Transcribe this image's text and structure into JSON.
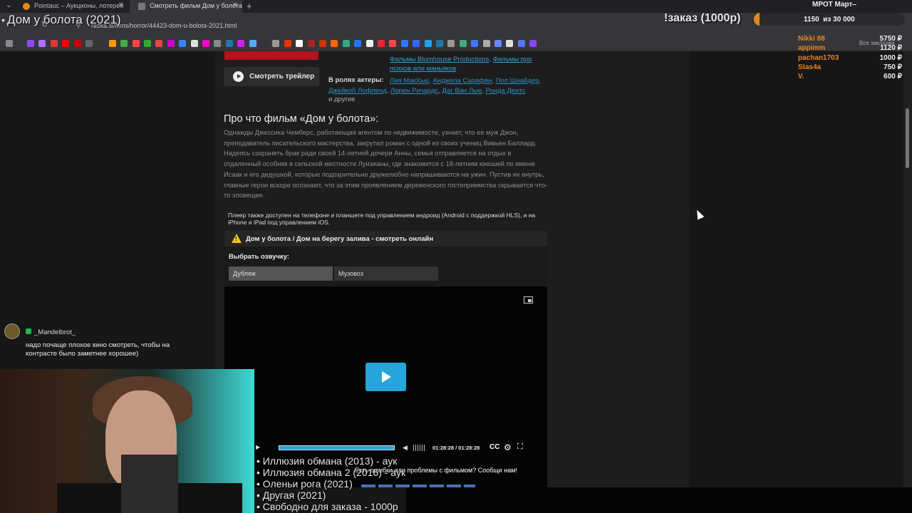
{
  "browser": {
    "tabs": [
      {
        "label": "Pointauc – Аукционы, лотерея",
        "active": false
      },
      {
        "label": "Смотреть фильм Дом у болота",
        "active": true
      }
    ],
    "url": "rezka.si/films/horror/44423-dom-u-bolota-2021.html",
    "all_bookmarks": "Все закладки"
  },
  "stream": {
    "title": "Дом у болота (2021)",
    "order_label": "!заказ (1000р)",
    "goal_current": "1150",
    "goal_total": "из 30 000",
    "goal_progress": 0.038,
    "mrot_label": "МРОТ Март–",
    "donors": [
      {
        "name": "Nikki 88",
        "amount": "5750 ₽"
      },
      {
        "name": "appimm",
        "amount": "1120 ₽"
      },
      {
        "name": "pachan1703",
        "amount": "1000 ₽"
      },
      {
        "name": "Stas4a",
        "amount": "750 ₽"
      },
      {
        "name": "V.",
        "amount": "600 ₽"
      }
    ],
    "chat": {
      "user": "_Mandelbrot_",
      "message": "надо почаще плохое кино смотреть, чтобы на контрасте было заметнее хорошее)"
    },
    "queue": [
      "Иллюзия обмана (2013) - аук",
      "Иллюзия обмана 2 (2016) - аук",
      "Оленьи рога (2021)",
      "Другая (2021)",
      "Свободно для заказа - 1000р"
    ]
  },
  "page": {
    "trailer_button": "Смотреть трейлер",
    "genre_links": [
      "Фильмы Blumhouse Productions",
      "Фильмы про психов или маньяков"
    ],
    "actors_label": "В ролях актеры:",
    "actors": [
      "Лия МакХью",
      "Анджела Сарафян",
      "Пол Шнайдер",
      "Джейкоб Лофленд",
      "Лорен Ричардс",
      "Даг Ван Лью",
      "Ронда Дентс"
    ],
    "actors_more": "и другие",
    "about_title": "Про что фильм «Дом у болота»:",
    "about_text": "Однажды Джессика Чемберс, работающая агентом по недвижимости, узнает, что ее муж Джон, преподаватель писательского мастерства, закрутил роман с одной из своих учениц Вивьен Баллард. Надеясь сохранить брак ради своей 14-летней дочери Анны, семья отправляется на отдых в отдаленный особняк в сельской местности Луизианы, где знакомится с 18-летним юношей по имени Исаак и его дедушкой, которые подозрительно дружелюбно напрашиваются на ужин. Пустив их внутрь, главные герои вскоре осознают, что за этим проявлением деревенского гостеприимства скрывается что-то зловещее.",
    "player_note": "Плеер также доступен на телефоне и планшете под управлением андроид (Android с поддержкой HLS), и на iPhone и iPad под управлением iOS.",
    "player_header": "Дом у болота / Дом на берегу залива - смотреть онлайн",
    "voice_label": "Выбрать озвучку:",
    "voices": [
      "Дубляж",
      "Музовоз"
    ],
    "timecode": "01:28:28 / 01:28:28",
    "cc_label": "CC",
    "report": "Есть ошибки или проблемы с фильмом? Сообщи нам!"
  },
  "colors": {
    "accent": "#26a6dc",
    "link": "#2f9fd8",
    "orange": "#e8861c",
    "brand_red": "#b3151a"
  }
}
